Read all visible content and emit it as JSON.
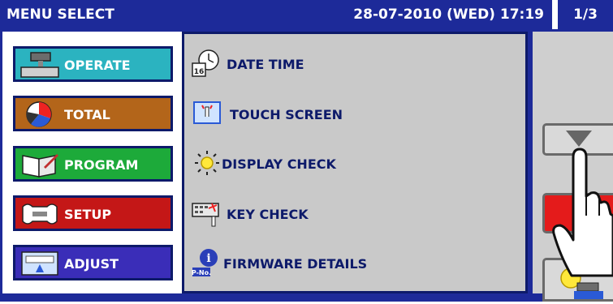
{
  "titlebar": {
    "title": "MENU SELECT",
    "datetime": "28-07-2010 (WED) 17:19",
    "page": "1/3"
  },
  "categories": [
    {
      "label": "OPERATE",
      "icon": "operate-icon",
      "color": "#2bb3c0"
    },
    {
      "label": "TOTAL",
      "icon": "pie-chart-icon",
      "color": "#b3651a"
    },
    {
      "label": "PROGRAM",
      "icon": "book-icon",
      "color": "#1daa3a"
    },
    {
      "label": "SETUP",
      "icon": "wrench-icon",
      "color": "#c41717"
    },
    {
      "label": "ADJUST",
      "icon": "adjust-icon",
      "color": "#3a2db8"
    }
  ],
  "items": [
    {
      "label": "DATE TIME",
      "icon": "clock-calendar-icon"
    },
    {
      "label": "TOUCH SCREEN",
      "icon": "touch-screen-icon"
    },
    {
      "label": "DISPLAY CHECK",
      "icon": "sun-icon"
    },
    {
      "label": "KEY CHECK",
      "icon": "keyboard-icon"
    },
    {
      "label": "FIRMWARE DETAILS",
      "icon": "info-icon"
    }
  ],
  "colors": {
    "titlebar": "#1d2a99",
    "item_text": "#0d1a6a",
    "panel": "#c9c9c9"
  }
}
